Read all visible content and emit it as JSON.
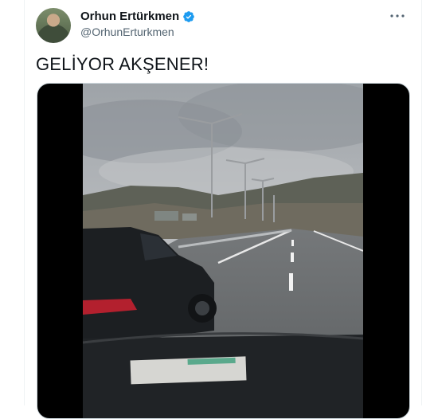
{
  "tweet": {
    "author": {
      "display_name": "Orhun Ertürkmen",
      "handle": "@OrhunErturkmen",
      "verified": true,
      "avatar_icon": "profile-photo"
    },
    "text": "GELİYOR AKŞENER!",
    "more_icon": "more-horizontal-icon",
    "media": {
      "type": "video",
      "scene": "highway-dashcam"
    }
  },
  "colors": {
    "verified_badge": "#1d9bf0",
    "handle": "#536471",
    "text": "#0f1419",
    "border": "#cfd9de"
  }
}
